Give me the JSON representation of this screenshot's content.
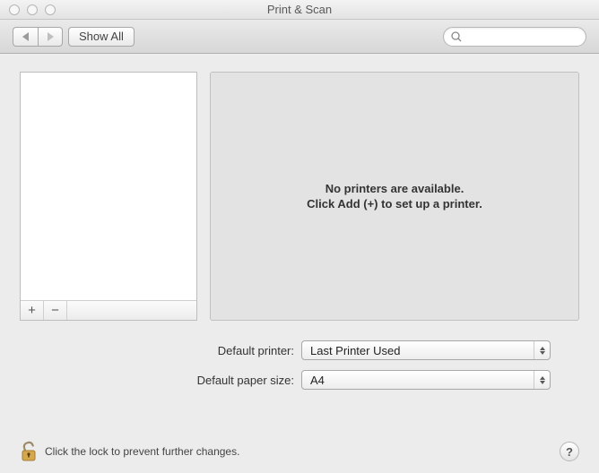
{
  "window": {
    "title": "Print & Scan"
  },
  "toolbar": {
    "show_all_label": "Show All",
    "search_placeholder": ""
  },
  "info": {
    "line1": "No printers are available.",
    "line2": "Click Add (+) to set up a printer."
  },
  "settings": {
    "default_printer_label": "Default printer:",
    "default_printer_value": "Last Printer Used",
    "default_paper_label": "Default paper size:",
    "default_paper_value": "A4"
  },
  "lock": {
    "text": "Click the lock to prevent further changes."
  },
  "footer": {
    "add_label": "+",
    "remove_label": "−"
  },
  "help": {
    "label": "?"
  }
}
